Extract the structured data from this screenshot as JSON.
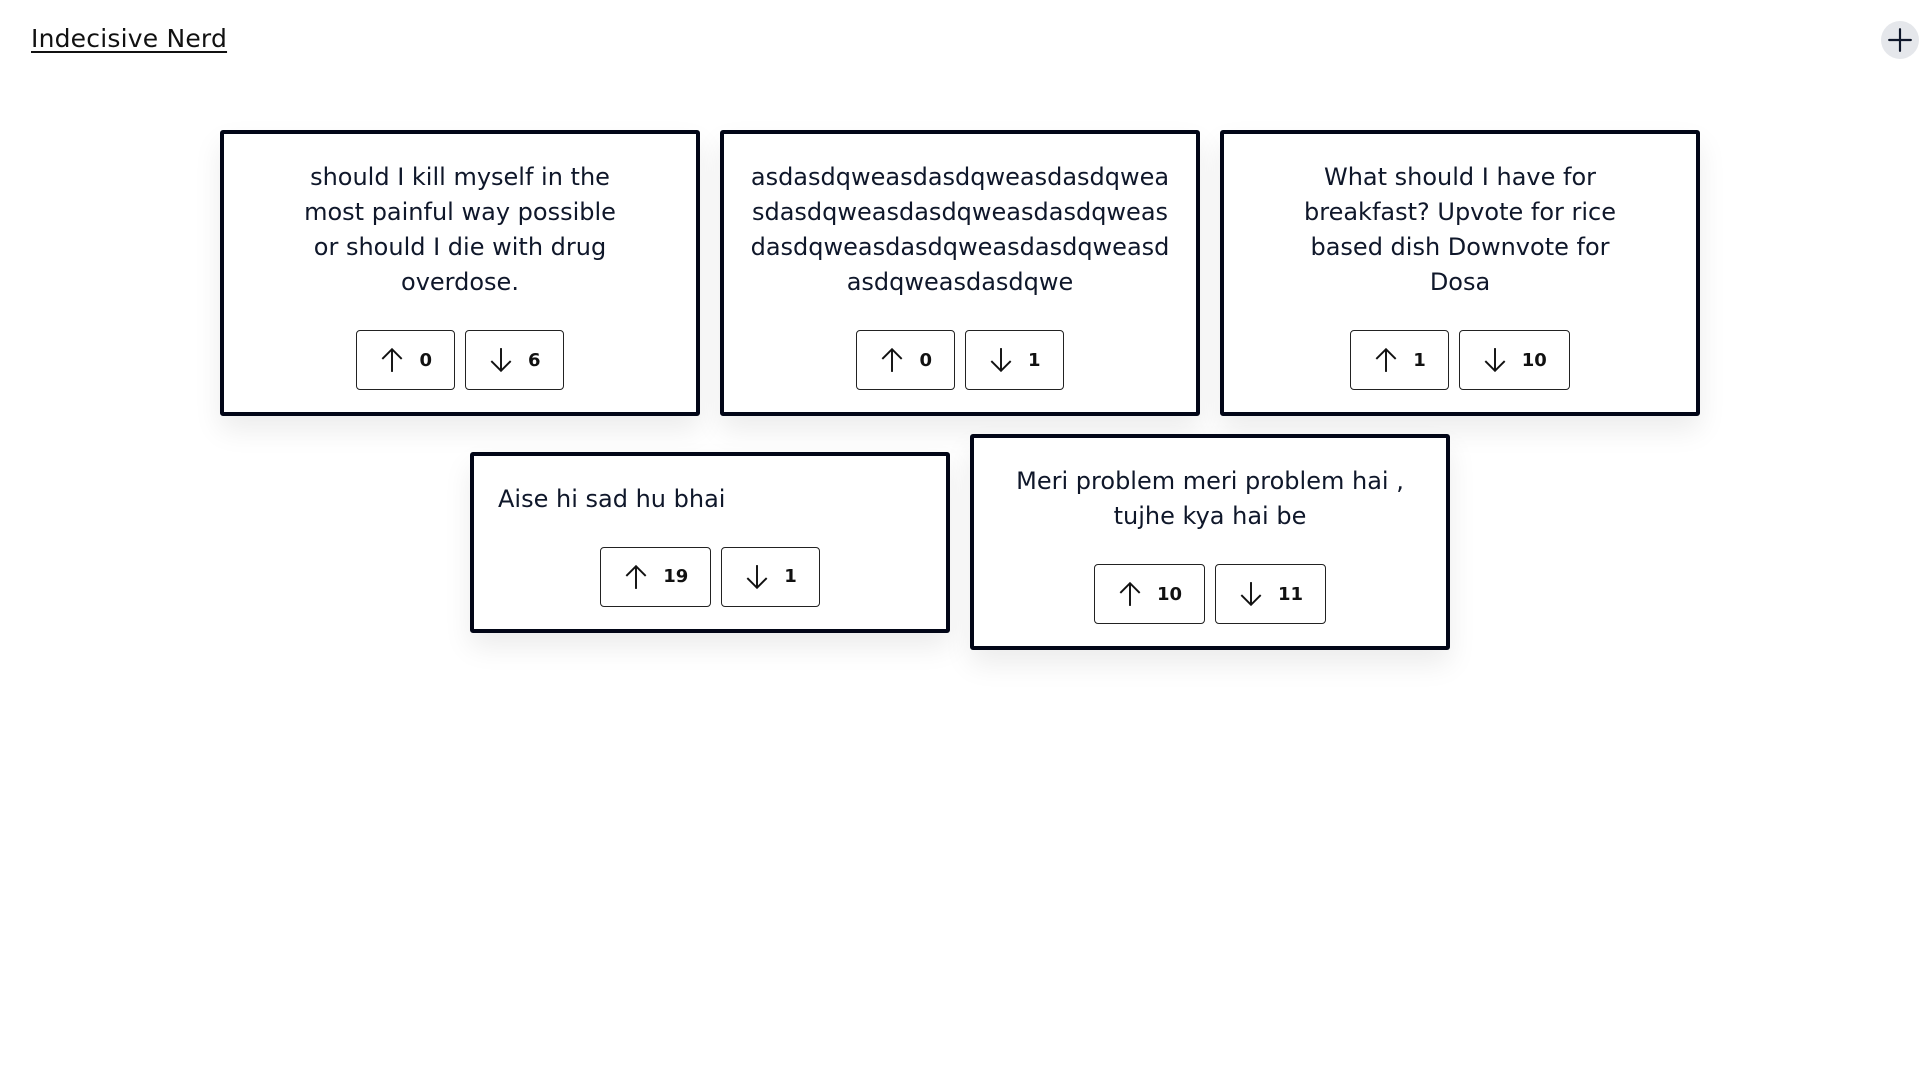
{
  "header": {
    "title": "Indecisive Nerd",
    "add_icon": "plus-icon"
  },
  "posts": [
    {
      "text": "should I kill myself in the most painful way possible or should I die with drug overdose.",
      "upvotes": "0",
      "downvotes": "6",
      "align": "center"
    },
    {
      "text": "asdasdqweasdasdqweasdasdqweasdasdqweasdasdqweasdasdqweasdasdqweasdasdqweasdasdqweasdasdqweasdasdqwe",
      "upvotes": "0",
      "downvotes": "1",
      "align": "center"
    },
    {
      "text": "What should I have for breakfast? Upvote for rice based dish Downvote for Dosa",
      "upvotes": "1",
      "downvotes": "10",
      "align": "center"
    },
    {
      "text": "Aise hi sad hu bhai",
      "upvotes": "19",
      "downvotes": "1",
      "align": "left"
    },
    {
      "text": "Meri problem meri problem hai , tujhe kya hai be",
      "upvotes": "10",
      "downvotes": "11",
      "align": "center"
    }
  ],
  "icons": {
    "upvote": "arrow-up-icon",
    "downvote": "arrow-down-icon"
  }
}
